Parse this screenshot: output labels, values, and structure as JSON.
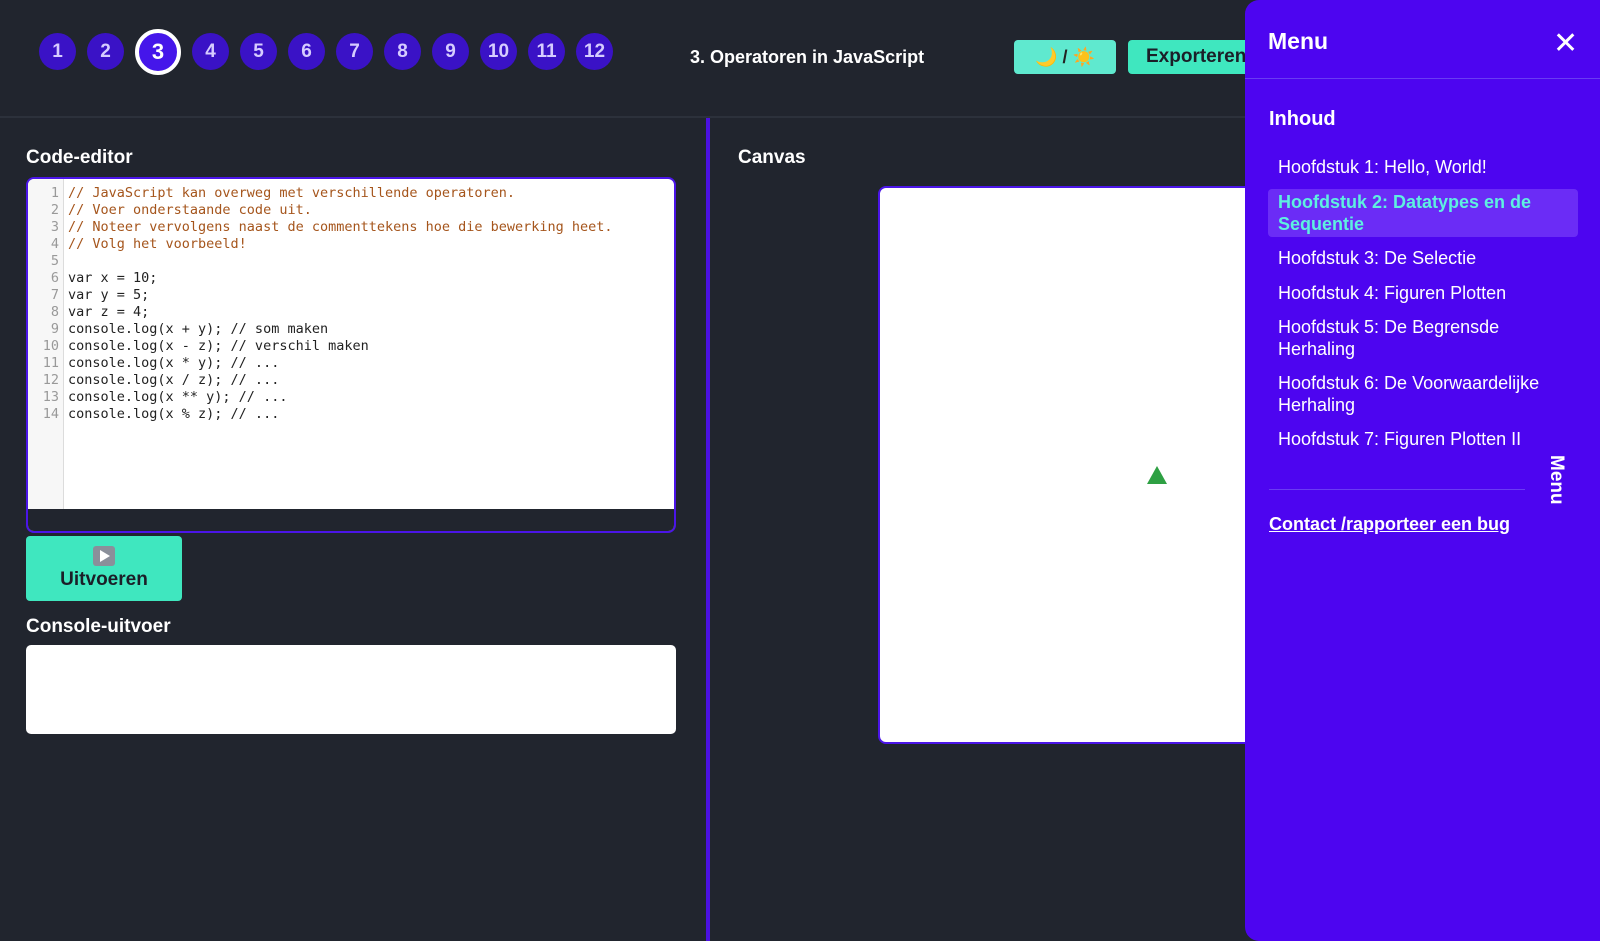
{
  "steps": [
    "1",
    "2",
    "3",
    "4",
    "5",
    "6",
    "7",
    "8",
    "9",
    "10",
    "11",
    "12"
  ],
  "active_step": "3",
  "lesson_title": "3. Operatoren in JavaScript",
  "theme_toggle": {
    "moon": "🌙",
    "separator": "/",
    "sun": "☀️"
  },
  "export_label": "Exporteren",
  "editor": {
    "label": "Code-editor",
    "lines": [
      {
        "n": "1",
        "text": "// JavaScript kan overweg met verschillende operatoren."
      },
      {
        "n": "2",
        "text": "// Voer onderstaande code uit."
      },
      {
        "n": "3",
        "text": "// Noteer vervolgens naast de commenttekens hoe die bewerking heet."
      },
      {
        "n": "4",
        "text": "// Volg het voorbeeld!"
      },
      {
        "n": "5",
        "text": ""
      },
      {
        "n": "6",
        "text": "var x = 10;"
      },
      {
        "n": "7",
        "text": "var y = 5;"
      },
      {
        "n": "8",
        "text": "var z = 4;"
      },
      {
        "n": "9",
        "text": "console.log(x + y); // som maken"
      },
      {
        "n": "10",
        "text": "console.log(x - z); // verschil maken"
      },
      {
        "n": "11",
        "text": "console.log(x * y); // ..."
      },
      {
        "n": "12",
        "text": "console.log(x / z); // ..."
      },
      {
        "n": "13",
        "text": "console.log(x ** y); // ..."
      },
      {
        "n": "14",
        "text": "console.log(x % z); // ..."
      }
    ]
  },
  "run_label": "Uitvoeren",
  "console_label": "Console-uitvoer",
  "canvas_label": "Canvas",
  "menu": {
    "title": "Menu",
    "close": "✕",
    "toc_heading": "Inhoud",
    "items": [
      "Hoofdstuk 1: Hello, World!",
      "Hoofdstuk 2: Datatypes en de Sequentie",
      "Hoofdstuk 3: De Selectie",
      "Hoofdstuk 4: Figuren Plotten",
      "Hoofdstuk 5: De Begrensde Herhaling",
      "Hoofdstuk 6: De Voorwaardelijke Herhaling",
      "Hoofdstuk 7: Figuren Plotten II"
    ],
    "vertical_tab": "Menu",
    "contact": "Contact /rapporteer een bug"
  }
}
